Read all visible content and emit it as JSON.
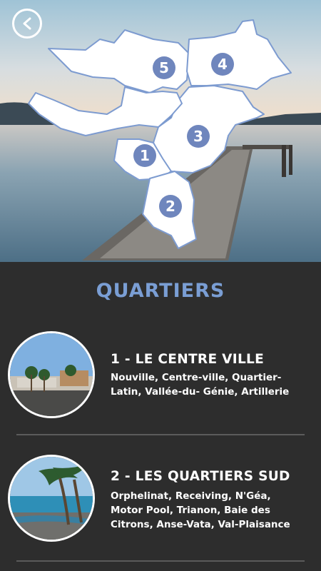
{
  "header": {
    "back_icon": "chevron-left-icon",
    "districts": [
      "1",
      "2",
      "3",
      "4",
      "5"
    ]
  },
  "section": {
    "title": "QUARTIERS"
  },
  "items": [
    {
      "title": "1 - LE CENTRE VILLE",
      "desc": "Nouville, Centre-ville, Quartier-Latin, Vallée-du- Génie, Artillerie"
    },
    {
      "title": "2 - LES QUARTIERS SUD",
      "desc": "Orphelinat, Receiving, N'Géa, Motor Pool, Trianon, Baie des Citrons, Anse-Vata, Val-Plaisance"
    }
  ],
  "colors": {
    "accent": "#7a9ed4",
    "badge": "#6f86bd",
    "background": "#2d2d2d"
  }
}
